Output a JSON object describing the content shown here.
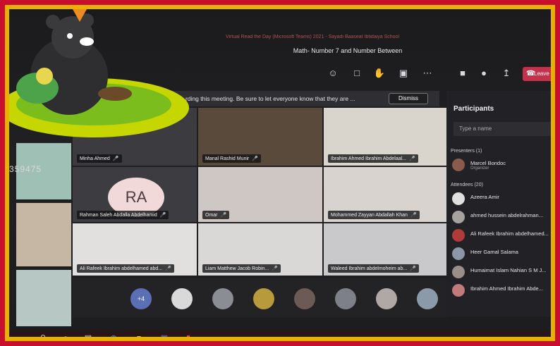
{
  "window": {
    "titlebar": "Virtual Read the Day (Microsoft Teams) 2021 - Sayadi Baaseat Ibtidaiya School",
    "meeting_title": "Math- Number 7 and Number Between"
  },
  "toolbar": {
    "leave_label": "Leave"
  },
  "banner": {
    "text": "rding this meeting. Be sure to let everyone know that they are ...",
    "dismiss_label": "Dismiss"
  },
  "tiles": [
    {
      "name": "Minha Ahmed",
      "bg": "#3b3b40"
    },
    {
      "name": "Manal Rashid Munir",
      "bg": "#5a4a3c"
    },
    {
      "name": "Ibrahim Ahmed Ibrahim Abdelaal...",
      "bg": "#d9d4cc"
    },
    {
      "name": "Rahman Saleh Abdalla Abdelhamid",
      "bg": "#3d3c41",
      "initials": "RA"
    },
    {
      "name": "Omar",
      "bg": "#cfc7c3"
    },
    {
      "name": "Mohammed Zayyan Abdallah Khan",
      "bg": "#d8d3cf"
    },
    {
      "name": "Ali Rafeek Ibrahim abdelhamed abd...",
      "bg": "#e2e0de"
    },
    {
      "name": "Liam Matthew Jacob Robin...",
      "bg": "#dad8d6"
    },
    {
      "name": "Waleed Ibrahim abdelmoheim ab...",
      "bg": "#c9c9cc"
    }
  ],
  "strip": {
    "more_label": "+4",
    "avatars": [
      "",
      "",
      "",
      "",
      "",
      "",
      "",
      ""
    ]
  },
  "panel": {
    "title": "Participants",
    "search_placeholder": "Type a name",
    "presenters_label": "Presenters (1)",
    "attendees_label": "Attendees (20)",
    "presenters": [
      {
        "name": "Marcel Bondoc",
        "role": "Organizer"
      }
    ],
    "attendees": [
      {
        "name": "Azeera Amir"
      },
      {
        "name": "ahmed hussein abdelrahman..."
      },
      {
        "name": "Ali Rafeek Ibrahim abdelhamed..."
      },
      {
        "name": "Heer Gamal Salama"
      },
      {
        "name": "Humaimat Islam Nahian S M J..."
      },
      {
        "name": "Ibrahim Ahmed Ibrahim Abde..."
      }
    ]
  },
  "desk": {
    "phone_number": "359475"
  },
  "colors": {
    "frame": "#c8102e",
    "border": "#e8b100",
    "leave": "#c4314b"
  }
}
